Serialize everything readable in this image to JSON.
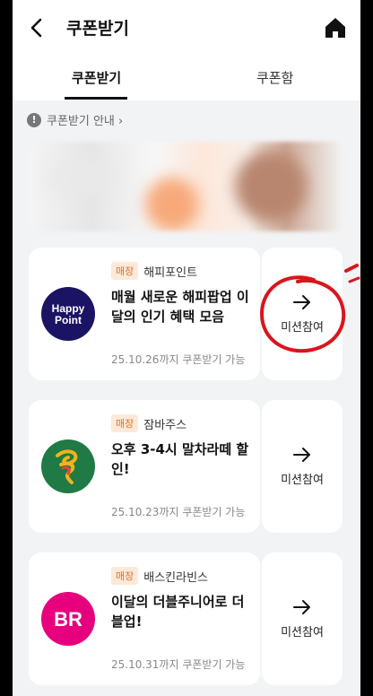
{
  "header": {
    "title": "쿠폰받기",
    "back_icon": "back-arrow-icon",
    "home_icon": "home-icon"
  },
  "tabs": [
    {
      "label": "쿠폰받기",
      "active": true
    },
    {
      "label": "쿠폰함",
      "active": false
    }
  ],
  "notice": {
    "label": "쿠폰받기 안내 ›",
    "icon": "info-icon"
  },
  "coupons": [
    {
      "tag": "매장",
      "brand": "해피포인트",
      "headline": "매월 새로운 해피팝업 이달의 인기 혜택 모음",
      "expire": "25.10.26까지 쿠폰받기 가능",
      "action": "미션참여",
      "logo_text_1": "Happy",
      "logo_text_2": "Point",
      "logo_color": "#1b1464"
    },
    {
      "tag": "매장",
      "brand": "잠바주스",
      "headline": "오후 3-4시 말차라떼 할인!",
      "expire": "25.10.23까지 쿠폰받기 가능",
      "action": "미션참여",
      "logo_color": "#1f7a45"
    },
    {
      "tag": "매장",
      "brand": "배스킨라빈스",
      "headline": "이달의 더블주니어로 더블업!",
      "expire": "25.10.31까지 쿠폰받기 가능",
      "action": "미션참여",
      "logo_text_1": "BR",
      "logo_color": "#e6007e"
    }
  ],
  "colors": {
    "tag_bg": "#fde9d8",
    "tag_text": "#e2702f",
    "annotation": "#d8161c"
  }
}
